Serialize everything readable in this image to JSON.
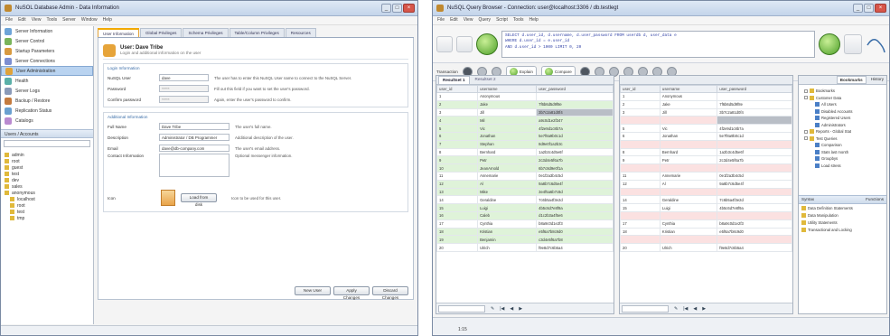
{
  "win1": {
    "title": "NuSOL Database Admin - Data Information",
    "menu": [
      "File",
      "Edit",
      "View",
      "Tools",
      "Server",
      "Window",
      "Help"
    ],
    "nav": [
      {
        "label": "Server Information",
        "color": "#6da4d8"
      },
      {
        "label": "Server Control",
        "color": "#79b45a"
      },
      {
        "label": "Startup Parameters",
        "color": "#d89a40"
      },
      {
        "label": "Server Connections",
        "color": "#7c8ed1"
      },
      {
        "label": "User Administration",
        "color": "#e0a33a",
        "selected": true
      },
      {
        "label": "Health",
        "color": "#5ab0a8"
      },
      {
        "label": "Server Logs",
        "color": "#8a9ab8"
      },
      {
        "label": "Backup / Restore",
        "color": "#c47b3f"
      },
      {
        "label": "Replication Status",
        "color": "#6aa0d0"
      },
      {
        "label": "Catalogs",
        "color": "#b98ad0"
      }
    ],
    "section_title": "Users / Accounts",
    "tree": [
      "admin",
      "root",
      "guest",
      "test",
      "dev",
      "sales",
      "anonymous",
      "localhost",
      "root",
      "test",
      "tmp"
    ],
    "tabs": [
      "User Information",
      "Global Privileges",
      "Schema Privileges",
      "Table/Column Privileges",
      "Resources"
    ],
    "header_title": "User: Dave Tribe",
    "header_sub": "Login and additional information on the user",
    "login_group": "Login Information",
    "login": [
      {
        "label": "NuSQL User",
        "value": "dave",
        "desc": "The user has to enter this NuSQL User name to connect to the NuSQL Server.",
        "disabled": false
      },
      {
        "label": "Password",
        "value": "*****",
        "desc": "Fill out this field if you want to set the user's password.",
        "disabled": true
      },
      {
        "label": "Confirm password",
        "value": "*****",
        "desc": "Again, enter the user's password to confirm.",
        "disabled": true
      }
    ],
    "add_group": "Additional Information",
    "additional": [
      {
        "label": "Full Name",
        "value": "Dave Tribe",
        "desc": "The user's full name."
      },
      {
        "label": "Description",
        "value": "Administrator / DB Programmer",
        "desc": "Additional description of the user."
      },
      {
        "label": "Email",
        "value": "dave@db-company.com",
        "desc": "The user's email address."
      }
    ],
    "contact_label": "Contact Information",
    "contact_desc": "Optional messenger information.",
    "icon_label": "Icon",
    "load_button": "Load from disk",
    "icon_desc": "Icon to be used for this user.",
    "buttons": [
      "New User",
      "Apply Changes",
      "Discard Changes"
    ]
  },
  "win2": {
    "title": "NuSQL Query Browser - Connection: user@localhost:3306 / db.testlegt",
    "menu": [
      "File",
      "Edit",
      "View",
      "Query",
      "Script",
      "Tools",
      "Help"
    ],
    "sql_lines": [
      "SELECT d.user_id, d.username, d.user_password FROM userdb d, user_data e",
      "  WHERE d.user_id = e.user_id",
      "  AND d.user_id > 1000 LIMIT 0, 20"
    ],
    "execute_label": "Execute",
    "stop_label": "Stop",
    "tb3_label": "Transaction",
    "pill_labels": [
      "Explain",
      "Compare"
    ],
    "left_tabs": [
      "Resultset 1",
      "Resultset 2"
    ],
    "right_tabs": [
      "Bookmarks",
      "History"
    ],
    "columns": [
      "user_id",
      "username",
      "user_password"
    ],
    "left_rows": [
      {
        "c": [
          "1",
          "Anonymous",
          ""
        ],
        "t": "y"
      },
      {
        "c": [
          "2",
          "Jake",
          "7f6b6d5d9f8e"
        ],
        "t": "g"
      },
      {
        "c": [
          "3",
          "Jill",
          "3b7c2a81d0f4"
        ],
        "t": "y",
        "sel": true
      },
      {
        "c": [
          "4",
          "Mil",
          "a9c0d1e2f347"
        ],
        "t": "g"
      },
      {
        "c": [
          "5",
          "Vic",
          "4f2e9d1c8b7a"
        ],
        "t": "g"
      },
      {
        "c": [
          "6",
          "Jonathan",
          "5e7f8a9b0c1d"
        ],
        "t": "g"
      },
      {
        "c": [
          "7",
          "Stephan",
          "8d9e0f1a2b3c"
        ],
        "t": "g"
      },
      {
        "c": [
          "8",
          "Bernhard",
          "1a2b3c4d5e6f"
        ],
        "t": "y"
      },
      {
        "c": [
          "9",
          "Petr",
          "2c3d4e5f6a7b"
        ],
        "t": "g"
      },
      {
        "c": [
          "10",
          "JeanArnold",
          "6b7c8d9e0f1a"
        ],
        "t": "g"
      },
      {
        "c": [
          "11",
          "Annemarie",
          "0e1f2a3b4c5d"
        ],
        "t": "y"
      },
      {
        "c": [
          "12",
          "Al",
          "9a8b7c6d5e4f"
        ],
        "t": "g"
      },
      {
        "c": [
          "13",
          "Mike",
          "3e4f5a6b7c8d"
        ],
        "t": "g"
      },
      {
        "c": [
          "14",
          "Geraldine",
          "7c6b5a4f3e2d"
        ],
        "t": "y"
      },
      {
        "c": [
          "15",
          "Luigi",
          "4b5c6d7e8f9a"
        ],
        "t": "g"
      },
      {
        "c": [
          "16",
          "Caleb",
          "d1c2b3a4f5e6"
        ],
        "t": "g"
      },
      {
        "c": [
          "17",
          "Cynthia",
          "b8a9c0d1e2f3"
        ],
        "t": "y"
      },
      {
        "c": [
          "18",
          "Kristian",
          "e5f6a7b8c9d0"
        ],
        "t": "g"
      },
      {
        "c": [
          "19",
          "Benjamin",
          "c3d4e5f6a7b8"
        ],
        "t": "g"
      },
      {
        "c": [
          "20",
          "Ulrich",
          "f9e8d7c6b5a4"
        ],
        "t": "y"
      }
    ],
    "right_rows": [
      {
        "c": [
          "1",
          "Anonymous",
          ""
        ],
        "t": "y"
      },
      {
        "c": [
          "2",
          "Jake",
          "7f6b6d5d9f8e"
        ],
        "t": "y"
      },
      {
        "c": [
          "3",
          "Jill",
          "3b7c2a81d0f4"
        ],
        "t": "y"
      },
      {
        "c": [
          "",
          "",
          ""
        ],
        "t": "r",
        "sel": true
      },
      {
        "c": [
          "5",
          "Vic",
          "4f2e9d1c8b7a"
        ],
        "t": "y"
      },
      {
        "c": [
          "6",
          "Jonathan",
          "5e7f8a9b0c1d"
        ],
        "t": "y"
      },
      {
        "c": [
          "",
          "",
          ""
        ],
        "t": "r"
      },
      {
        "c": [
          "8",
          "Bernhard",
          "1a2b3c4d5e6f"
        ],
        "t": "y"
      },
      {
        "c": [
          "9",
          "Petr",
          "2c3d4e5f6a7b"
        ],
        "t": "y"
      },
      {
        "c": [
          "",
          "",
          ""
        ],
        "t": "r"
      },
      {
        "c": [
          "11",
          "Annemarie",
          "0e1f2a3b4c5d"
        ],
        "t": "y"
      },
      {
        "c": [
          "12",
          "Al",
          "9a8b7c6d5e4f"
        ],
        "t": "y"
      },
      {
        "c": [
          "",
          "",
          ""
        ],
        "t": "r"
      },
      {
        "c": [
          "14",
          "Geraldine",
          "7c6b5a4f3e2d"
        ],
        "t": "y"
      },
      {
        "c": [
          "15",
          "Luigi",
          "4b5c6d7e8f9a"
        ],
        "t": "y"
      },
      {
        "c": [
          "",
          "",
          ""
        ],
        "t": "r"
      },
      {
        "c": [
          "17",
          "Cynthia",
          "b8a9c0d1e2f3"
        ],
        "t": "y"
      },
      {
        "c": [
          "18",
          "Kristian",
          "e5f6a7b8c9d0"
        ],
        "t": "y"
      },
      {
        "c": [
          "",
          "",
          ""
        ],
        "t": "r"
      },
      {
        "c": [
          "20",
          "Ulrich",
          "f9e8d7c6b5a4"
        ],
        "t": "y"
      }
    ],
    "tree": [
      {
        "t": "Bookmarks",
        "k": "folder"
      },
      {
        "t": "Customer Data",
        "k": "folder"
      },
      {
        "t": "All Users",
        "k": "item"
      },
      {
        "t": "Disabled Accounts",
        "k": "item"
      },
      {
        "t": "Registered Users",
        "k": "item"
      },
      {
        "t": "Administrators",
        "k": "item"
      },
      {
        "t": "Reports - Global Stat",
        "k": "folder"
      },
      {
        "t": "Test Queries",
        "k": "folder"
      },
      {
        "t": "Comparison",
        "k": "item"
      },
      {
        "t": "Stats last month",
        "k": "item"
      },
      {
        "t": "Groupbys",
        "k": "item"
      },
      {
        "t": "Load stress",
        "k": "item"
      }
    ],
    "lower_sec": "Syntax",
    "lower_sec_right": "Functions",
    "lower_list": [
      "Data Definition Statements",
      "Data Manipulation",
      "Utility Statements",
      "Transactional and Locking"
    ],
    "status": "1:15"
  }
}
